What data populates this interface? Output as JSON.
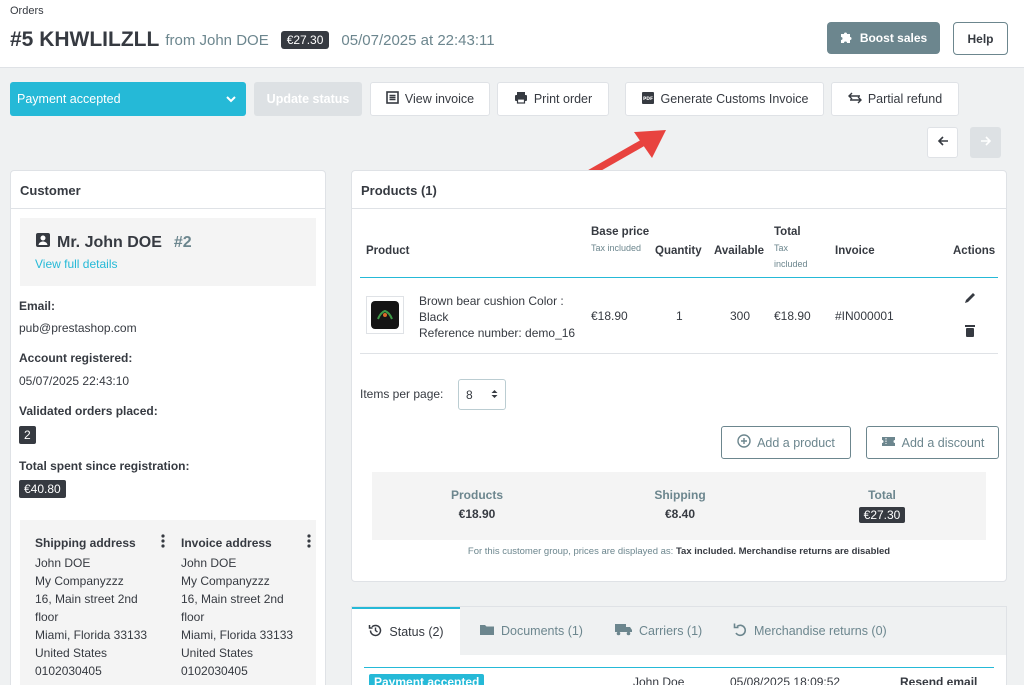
{
  "breadcrumb": "Orders",
  "header": {
    "order_id": "#5 KHWLILZLL",
    "from": "from John DOE",
    "total_badge": "€27.30",
    "date": "05/07/2025 at 22:43:11",
    "boost_label": "Boost sales",
    "help_label": "Help"
  },
  "toolbar": {
    "status_value": "Payment accepted",
    "update_label": "Update status",
    "view_invoice": "View invoice",
    "print_order": "Print order",
    "customs_invoice": "Generate Customs Invoice",
    "partial_refund": "Partial refund"
  },
  "customer": {
    "panel_title": "Customer",
    "name": "Mr. John DOE",
    "number": "#2",
    "view_details": "View full details",
    "email_label": "Email:",
    "email": "pub@prestashop.com",
    "registered_label": "Account registered:",
    "registered": "05/07/2025 22:43:10",
    "validated_label": "Validated orders placed:",
    "validated": "2",
    "spent_label": "Total spent since registration:",
    "spent": "€40.80",
    "shipping": {
      "title": "Shipping address",
      "lines": [
        "John DOE",
        "My Companyzzz",
        "16, Main street 2nd",
        "floor",
        "Miami, Florida 33133",
        "United States",
        "0102030405"
      ]
    },
    "invoice": {
      "title": "Invoice address",
      "lines": [
        "John DOE",
        "My Companyzzz",
        "16, Main street 2nd",
        "floor",
        "Miami, Florida 33133",
        "United States",
        "0102030405"
      ]
    }
  },
  "products": {
    "panel_title": "Products (1)",
    "headers": {
      "product": "Product",
      "base_price": "Base price",
      "base_price_sub": "Tax included",
      "quantity": "Quantity",
      "available": "Available",
      "total": "Total",
      "total_sub": "Tax included",
      "invoice": "Invoice",
      "actions": "Actions"
    },
    "row": {
      "name": "Brown bear cushion Color : Black",
      "reference": "Reference number: demo_16",
      "base_price": "€18.90",
      "quantity": "1",
      "available": "300",
      "total": "€18.90",
      "invoice": "#IN000001"
    },
    "items_per_page_label": "Items per page:",
    "items_per_page": "8",
    "add_product": "Add a product",
    "add_discount": "Add a discount",
    "totals": {
      "products_label": "Products",
      "products": "€18.90",
      "shipping_label": "Shipping",
      "shipping": "€8.40",
      "total_label": "Total",
      "total": "€27.30"
    },
    "note_prefix": "For this customer group, prices are displayed as: ",
    "note_bold": "Tax included. Merchandise returns are disabled"
  },
  "tabs": {
    "status": "Status (2)",
    "documents": "Documents (1)",
    "carriers": "Carriers (1)",
    "returns": "Merchandise returns (0)"
  },
  "history": {
    "status": "Payment accepted",
    "employee": "John Doe",
    "date": "05/08/2025 18:09:52",
    "action": "Resend email"
  },
  "colors": {
    "primary": "#25b9d7",
    "dark": "#363a41",
    "secondary": "#6c868e",
    "arrow": "#e8433f"
  }
}
